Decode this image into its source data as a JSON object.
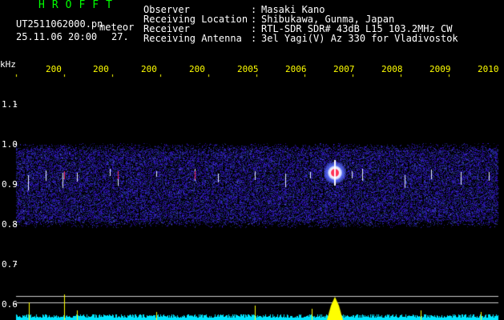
{
  "header": {
    "brand": "HROFFT",
    "filename": "UT2511062000.pn",
    "meteor_label": "meteor",
    "datetime": "25.11.06 20:00",
    "count": "27.",
    "info_labels": [
      "Observer",
      "Receiving Location",
      "Receiver",
      "Receiving Antenna"
    ],
    "info_colons": [
      ":",
      ":",
      ":",
      ":"
    ],
    "info_values": [
      "Masaki Kano",
      "Shibukawa, Gunma, Japan",
      "RTL-SDR SDR# 43dB L15 103.2MHz CW",
      "3el Yagi(V) Az 330 for Vladivostok"
    ]
  },
  "axes": {
    "y_unit": "kHz",
    "y_ticks": [
      "1.1",
      "1.0",
      "0.9",
      "0.8",
      "0.7",
      "0.6"
    ],
    "x_ticks": [
      "200",
      "200",
      "200",
      "200",
      "2005",
      "2006",
      "2007",
      "2008",
      "2009",
      "2010"
    ]
  },
  "colors": {
    "background": "#000000",
    "text": "#ffffff",
    "yellow": "#ffff00",
    "brand": "#00ff00",
    "noise_band": "#1a2a9a",
    "meteor": "#ff3355",
    "baseline": "#00e6ff"
  }
}
